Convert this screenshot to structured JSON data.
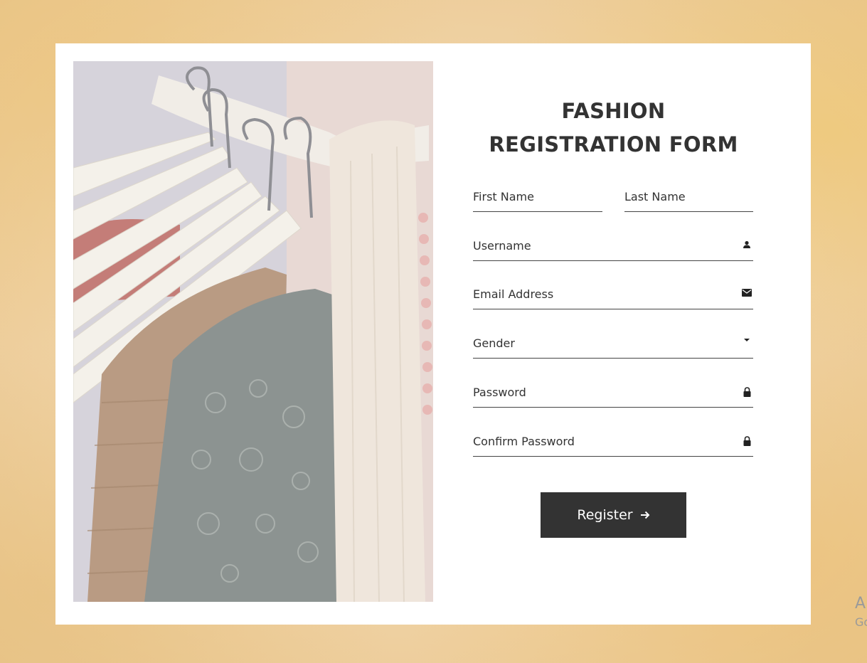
{
  "form": {
    "title_line1": "FASHION",
    "title_line2": "REGISTRATION FORM",
    "first_name_label": "First Name",
    "last_name_label": "Last Name",
    "username_label": "Username",
    "email_label": "Email Address",
    "gender_label": "Gender",
    "password_label": "Password",
    "confirm_password_label": "Confirm Password",
    "register_label": "Register"
  },
  "icons": {
    "username": "person-icon",
    "email": "envelope-icon",
    "gender": "caret-down-icon",
    "password": "lock-icon",
    "confirm_password": "lock-icon",
    "register": "arrow-right-icon"
  },
  "watermark": {
    "line1": "A",
    "line2": "Go"
  },
  "colors": {
    "button_bg": "#333333",
    "text": "#333333",
    "card_bg": "#ffffff"
  }
}
